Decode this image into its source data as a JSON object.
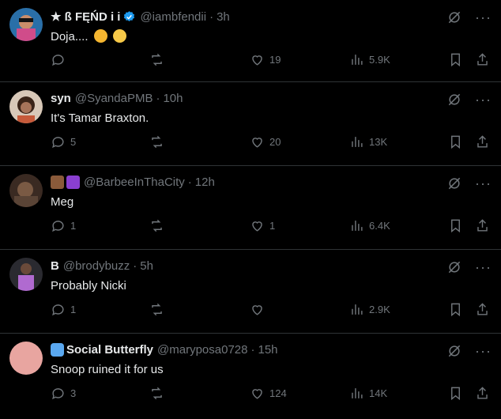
{
  "posts": [
    {
      "name": "★ ß FĘŃD i i",
      "handle": "@iambfendii",
      "time": "3h",
      "text": "Doja....",
      "reply_count": "",
      "like_count": "19",
      "view_count": "5.9K",
      "verified": true,
      "avatar_color": "#3a8fd0"
    },
    {
      "name": "syn",
      "handle": "@SyandaPMB",
      "time": "10h",
      "text": "It's Tamar Braxton.",
      "reply_count": "5",
      "like_count": "20",
      "view_count": "13K",
      "avatar_color": "#b58a6a"
    },
    {
      "name": "",
      "handle": "@BarbeeInThaCity",
      "time": "12h",
      "text": "Meg",
      "reply_count": "1",
      "like_count": "1",
      "view_count": "6.4K",
      "avatar_color": "#6b5b4a"
    },
    {
      "name": "B",
      "handle": "@brodybuzz",
      "time": "5h",
      "text": "Probably Nicki",
      "reply_count": "1",
      "like_count": "",
      "view_count": "2.9K",
      "avatar_color": "#4a4a55"
    },
    {
      "name": "Social Butterfly",
      "handle": "@maryposa0728",
      "time": "15h",
      "text": "Snoop ruined it for us",
      "reply_count": "3",
      "like_count": "124",
      "view_count": "14K",
      "avatar_color": "#e8a5a0"
    }
  ],
  "icons": {
    "reply": "reply-icon",
    "repost": "repost-icon",
    "like": "like-icon",
    "views": "views-icon",
    "bookmark": "bookmark-icon",
    "share": "share-icon",
    "grok": "grok-icon",
    "more": "more-icon"
  },
  "more_glyph": "···",
  "dot_separator": "·"
}
